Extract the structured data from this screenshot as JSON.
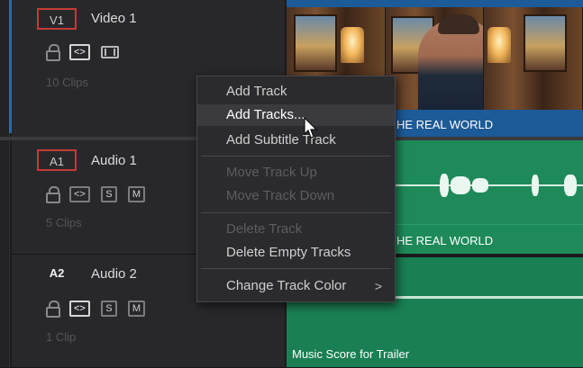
{
  "tracks": {
    "video1": {
      "id": "V1",
      "name": "Video 1",
      "clips": "10 Clips",
      "controls": [
        "<>"
      ]
    },
    "audio1": {
      "id": "A1",
      "name": "Audio 1",
      "clips": "5 Clips",
      "controls": [
        "<>",
        "S",
        "M"
      ]
    },
    "audio2": {
      "id": "A2",
      "name": "Audio 2",
      "clips": "1 Clip",
      "controls": [
        "<>",
        "S",
        "M"
      ]
    }
  },
  "timeline": {
    "video_clip_label": "HE REAL WORLD",
    "audio1_clip_label": "HE REAL WORLD",
    "audio2_clip_label": "Music Score for Trailer"
  },
  "context_menu": {
    "items": [
      {
        "label": "Add Track",
        "state": "enabled"
      },
      {
        "label": "Add Tracks...",
        "state": "highlighted"
      },
      {
        "label": "Add Subtitle Track",
        "state": "enabled"
      },
      {
        "label": "Move Track Up",
        "state": "disabled"
      },
      {
        "label": "Move Track Down",
        "state": "disabled"
      },
      {
        "label": "Delete Track",
        "state": "disabled"
      },
      {
        "label": "Delete Empty Tracks",
        "state": "enabled"
      },
      {
        "label": "Change Track Color",
        "state": "enabled",
        "submenu": ">"
      }
    ]
  },
  "icons": {
    "lock": "lock-icon",
    "link": "link-icon",
    "monitor": "film-icon",
    "cursor": "mouse-pointer-icon"
  },
  "colors": {
    "video_clip": "#1d5a98",
    "audio_clip": "#1e8a5a",
    "track_id_border": "#c23b36",
    "menu_bg": "#2b2b2e"
  }
}
